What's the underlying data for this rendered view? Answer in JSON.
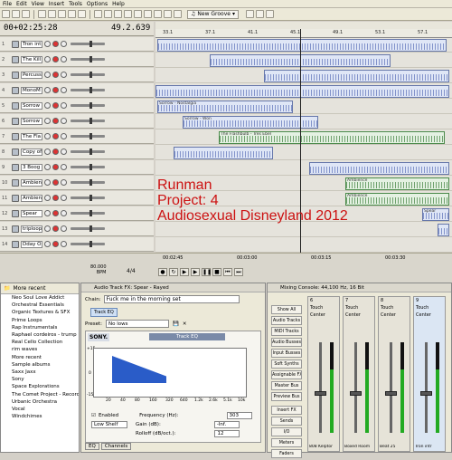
{
  "menu": [
    "File",
    "Edit",
    "View",
    "Insert",
    "Tools",
    "Options",
    "Help"
  ],
  "toolbar": {
    "groove": "New Groove"
  },
  "time": {
    "position": "00+02:25:28",
    "beats": "49.2.639"
  },
  "ruler": {
    "labels": [
      "33.1",
      "37.1",
      "41.1",
      "45.1",
      "49.1",
      "53.1",
      "57.1"
    ],
    "times": [
      "00:02:45",
      "00:03:00",
      "00:03:15",
      "00:03:30"
    ]
  },
  "tracks": [
    {
      "n": "1",
      "name": "Tron int"
    },
    {
      "n": "2",
      "name": "The Kill"
    },
    {
      "n": "3",
      "name": "Percuss"
    },
    {
      "n": "4",
      "name": "MonoM"
    },
    {
      "n": "5",
      "name": "Sorrow"
    },
    {
      "n": "6",
      "name": "Sorrow"
    },
    {
      "n": "7",
      "name": "The Fla"
    },
    {
      "n": "8",
      "name": "Copy of"
    },
    {
      "n": "9",
      "name": "3 Boog"
    },
    {
      "n": "10",
      "name": "Ambien"
    },
    {
      "n": "11",
      "name": "Ambien"
    },
    {
      "n": "12",
      "name": "Spear"
    },
    {
      "n": "13",
      "name": "triploop"
    },
    {
      "n": "14",
      "name": "Dday O"
    }
  ],
  "clips": {
    "sorrow": "Sorrow - Nostalgia",
    "sorrow_wor": "Sorrow - Won",
    "flashbulb": "The Flashbulb - Tres Ebel",
    "ambience": "Ambience",
    "spear": "Spear"
  },
  "overlay": {
    "line1": "Runman",
    "line2": "Project: 4",
    "line3": "Audiosexual Disneyland  2012"
  },
  "transport": {
    "rate": "80.000",
    "bpm": "BPM",
    "beats": "4/4"
  },
  "explorer": {
    "header": "More recent",
    "items": [
      "Neo Soul Love Addict",
      "Orchestral Essentials",
      "Organic Textures & SFX",
      "Prime Loops",
      "Rap Instrumentals",
      "Raphael cordeiros - trump",
      "Real Cello Collection",
      "rim waves",
      "More recent",
      "Sample albums",
      "Saxx Jaxx",
      "Sony",
      "Space Explorations",
      "The Comet Project - Recorc",
      "Urbanic Orchestra",
      "Vocal",
      "Windchimes"
    ]
  },
  "fx": {
    "title": "Audio Track FX: Spear - Rayed",
    "chain_label": "Chain:",
    "chain_value": "Fuck me in the morning set",
    "tab": "Track EQ",
    "preset_label": "Preset:",
    "preset_value": "No lows",
    "brand": "SONY.",
    "plugin": "Track EQ",
    "gain_scale": [
      "+15",
      "0",
      "-15"
    ],
    "freq_labels": [
      "20",
      "40",
      "80",
      "160",
      "320",
      "640",
      "1.2k",
      "2.6k",
      "5.1k",
      "10k"
    ],
    "enabled_label": "Enabled",
    "frequency_label": "Frequency (Hz):",
    "frequency_value": "303",
    "gain_label": "Gain (dB):",
    "gain_value": "-Inf.",
    "band_type": "Low Shelf",
    "rolloff_label": "Rolloff (dB/oct.):",
    "rolloff_value": "12",
    "bottom_tabs": [
      "EQ",
      "Channels"
    ]
  },
  "mixer": {
    "title": "Mixing Console: 44,100 Hz, 16 Bit",
    "side_buttons": [
      "Show All",
      "Audio Tracks",
      "MIDI Tracks",
      "Audio Busses",
      "Input Busses",
      "Soft Synths",
      "Assignable FX",
      "Master Bus",
      "Preview Bus",
      "Insert FX",
      "Sends",
      "I/O",
      "Meters",
      "Faders"
    ],
    "strips": [
      {
        "num": "6",
        "label": "Touch",
        "pan": "Center",
        "name": "808 Kelptor"
      },
      {
        "num": "7",
        "label": "Touch",
        "pan": "Center",
        "name": "Boxed Room"
      },
      {
        "num": "8",
        "label": "Touch",
        "pan": "Center",
        "name": "Beat 25"
      },
      {
        "num": "9",
        "label": "Touch",
        "pan": "Center",
        "name": "Tron intr"
      }
    ]
  }
}
